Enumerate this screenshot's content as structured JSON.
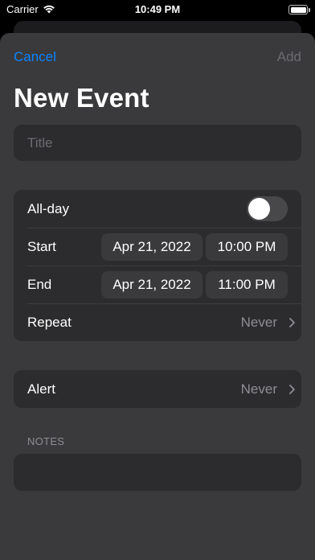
{
  "status_bar": {
    "carrier": "Carrier",
    "time": "10:49 PM",
    "battery_level": 1.0
  },
  "nav": {
    "cancel_label": "Cancel",
    "add_label": "Add"
  },
  "page": {
    "title": "New Event"
  },
  "title_field": {
    "placeholder": "Title",
    "value": ""
  },
  "event": {
    "all_day": {
      "label": "All-day",
      "on": false
    },
    "start": {
      "label": "Start",
      "date": "Apr 21, 2022",
      "time": "10:00 PM"
    },
    "end": {
      "label": "End",
      "date": "Apr 21, 2022",
      "time": "11:00 PM"
    },
    "repeat": {
      "label": "Repeat",
      "value": "Never"
    }
  },
  "alert": {
    "label": "Alert",
    "value": "Never"
  },
  "notes": {
    "header": "NOTES",
    "value": ""
  },
  "colors": {
    "accent": "#0a84ff",
    "sheet": "#3a3a3c",
    "cell": "#2c2c2e",
    "secondary_text": "#8e8e93"
  }
}
